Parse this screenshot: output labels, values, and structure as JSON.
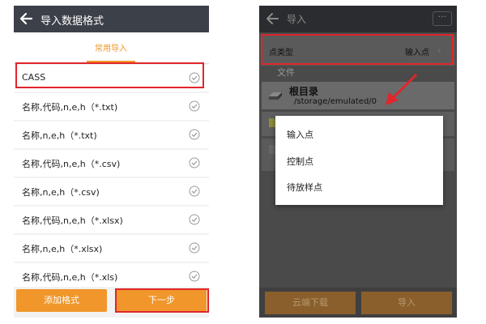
{
  "left": {
    "header_title": "导入数据格式",
    "tab_label": "常用导入",
    "formats": [
      "CASS",
      "名称,代码,n,e,h（*.txt)",
      "名称,n,e,h（*.txt)",
      "名称,代码,n,e,h（*.csv)",
      "名称,n,e,h（*.csv)",
      "名称,代码,n,e,h（*.xlsx)",
      "名称,n,e,h（*.xlsx)",
      "名称,代码,n,e,h（*.xls)"
    ],
    "add_format_label": "添加格式",
    "next_label": "下一步"
  },
  "right": {
    "header_title": "导入",
    "more_label": "···",
    "point_type_label": "点类型",
    "point_type_value": "输入点",
    "file_section_label": "文件",
    "root_dir_label": "根目录",
    "root_dir_path": "/storage/emulated/0",
    "popup_options": [
      "输入点",
      "控制点",
      "待放样点"
    ],
    "cloud_download_label": "云端下载",
    "import_label": "导入"
  },
  "colors": {
    "accent": "#f0962a",
    "highlight": "#e0262b",
    "header_dark": "#3c4049"
  }
}
